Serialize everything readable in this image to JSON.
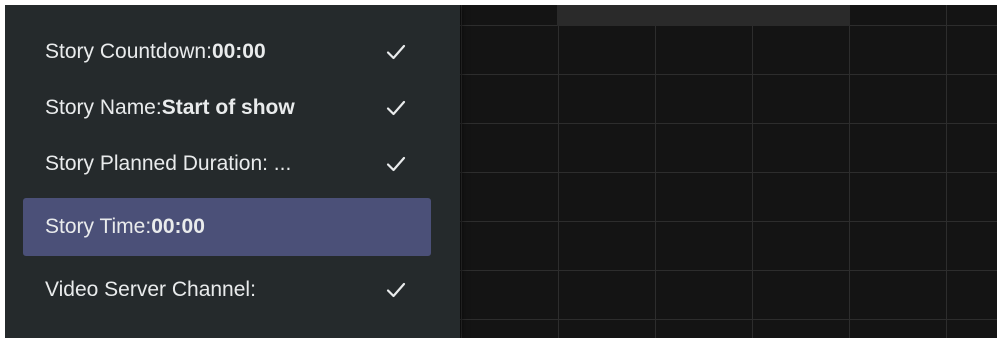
{
  "menu": {
    "items": [
      {
        "label": "Story Countdown: ",
        "value": "00:00",
        "checked": true,
        "selected": false
      },
      {
        "label": "Story Name: ",
        "value": "Start of show",
        "checked": true,
        "selected": false
      },
      {
        "label": "Story Planned Duration: ...",
        "value": "",
        "checked": true,
        "selected": false
      },
      {
        "label": "Story Time: ",
        "value": "00:00",
        "checked": false,
        "selected": true
      },
      {
        "label": "Video Server Channel:",
        "value": "",
        "checked": true,
        "selected": false
      }
    ]
  },
  "colors": {
    "menu_background": "#252a2c",
    "selected_background": "#4b5078",
    "grid_background": "#141414",
    "text": "#e9ebec"
  }
}
